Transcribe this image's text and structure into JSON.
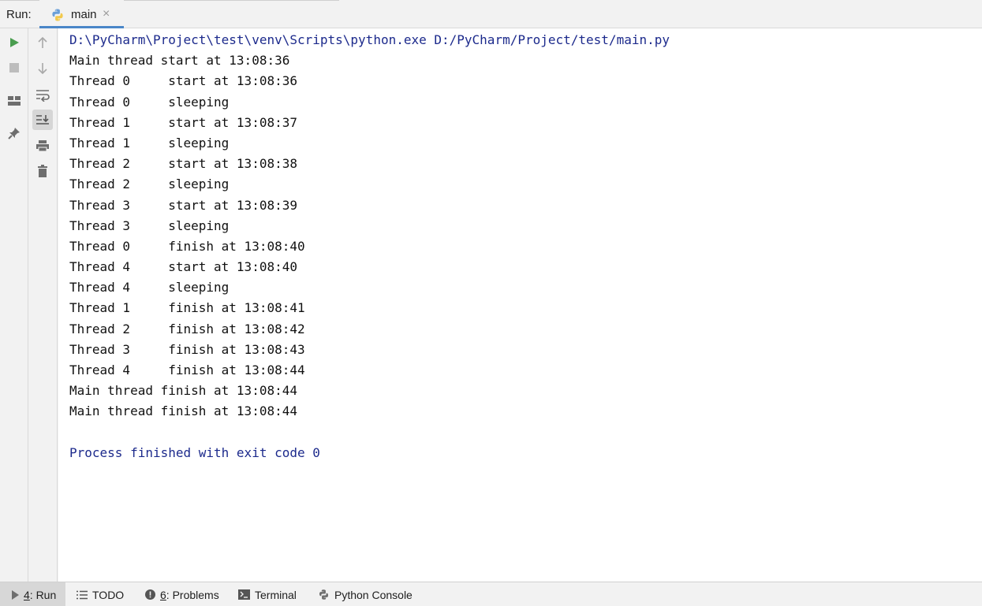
{
  "run_header": {
    "label": "Run:",
    "tab": {
      "label": "main",
      "close": "×"
    }
  },
  "toolbar_left": [
    "run-icon",
    "stop-icon",
    "layout-icon",
    "pin-icon"
  ],
  "toolbar_right": [
    "scroll-up-icon",
    "scroll-down-icon",
    "soft-wrap-icon",
    "scroll-to-end-icon",
    "print-icon",
    "trash-icon"
  ],
  "console": {
    "lines": [
      {
        "text": "D:\\PyCharm\\Project\\test\\venv\\Scripts\\python.exe D:/PyCharm/Project/test/main.py",
        "kind": "sys"
      },
      {
        "text": "Main thread start at 13:08:36",
        "kind": "out"
      },
      {
        "text": "Thread 0     start at 13:08:36",
        "kind": "out"
      },
      {
        "text": "Thread 0     sleeping",
        "kind": "out"
      },
      {
        "text": "Thread 1     start at 13:08:37",
        "kind": "out"
      },
      {
        "text": "Thread 1     sleeping",
        "kind": "out"
      },
      {
        "text": "Thread 2     start at 13:08:38",
        "kind": "out"
      },
      {
        "text": "Thread 2     sleeping",
        "kind": "out"
      },
      {
        "text": "Thread 3     start at 13:08:39",
        "kind": "out"
      },
      {
        "text": "Thread 3     sleeping",
        "kind": "out"
      },
      {
        "text": "Thread 0     finish at 13:08:40",
        "kind": "out"
      },
      {
        "text": "Thread 4     start at 13:08:40",
        "kind": "out"
      },
      {
        "text": "Thread 4     sleeping",
        "kind": "out"
      },
      {
        "text": "Thread 1     finish at 13:08:41",
        "kind": "out"
      },
      {
        "text": "Thread 2     finish at 13:08:42",
        "kind": "out"
      },
      {
        "text": "Thread 3     finish at 13:08:43",
        "kind": "out"
      },
      {
        "text": "Thread 4     finish at 13:08:44",
        "kind": "out"
      },
      {
        "text": "Main thread finish at 13:08:44",
        "kind": "out"
      },
      {
        "text": "Main thread finish at 13:08:44",
        "kind": "out"
      },
      {
        "text": "",
        "kind": "out"
      },
      {
        "text": "Process finished with exit code 0",
        "kind": "sys"
      }
    ]
  },
  "bottom_bar": {
    "run": {
      "mnemonic": "4",
      "label": ": Run"
    },
    "todo": {
      "label": "TODO"
    },
    "problems": {
      "mnemonic": "6",
      "label": ": Problems"
    },
    "terminal": {
      "label": "Terminal"
    },
    "python_console": {
      "label": "Python Console"
    }
  },
  "colors": {
    "run_green": "#4a9d4f",
    "icon_gray": "#8c8c8c",
    "sys_text": "#1c2a8c",
    "tab_accent": "#4a86c8"
  }
}
